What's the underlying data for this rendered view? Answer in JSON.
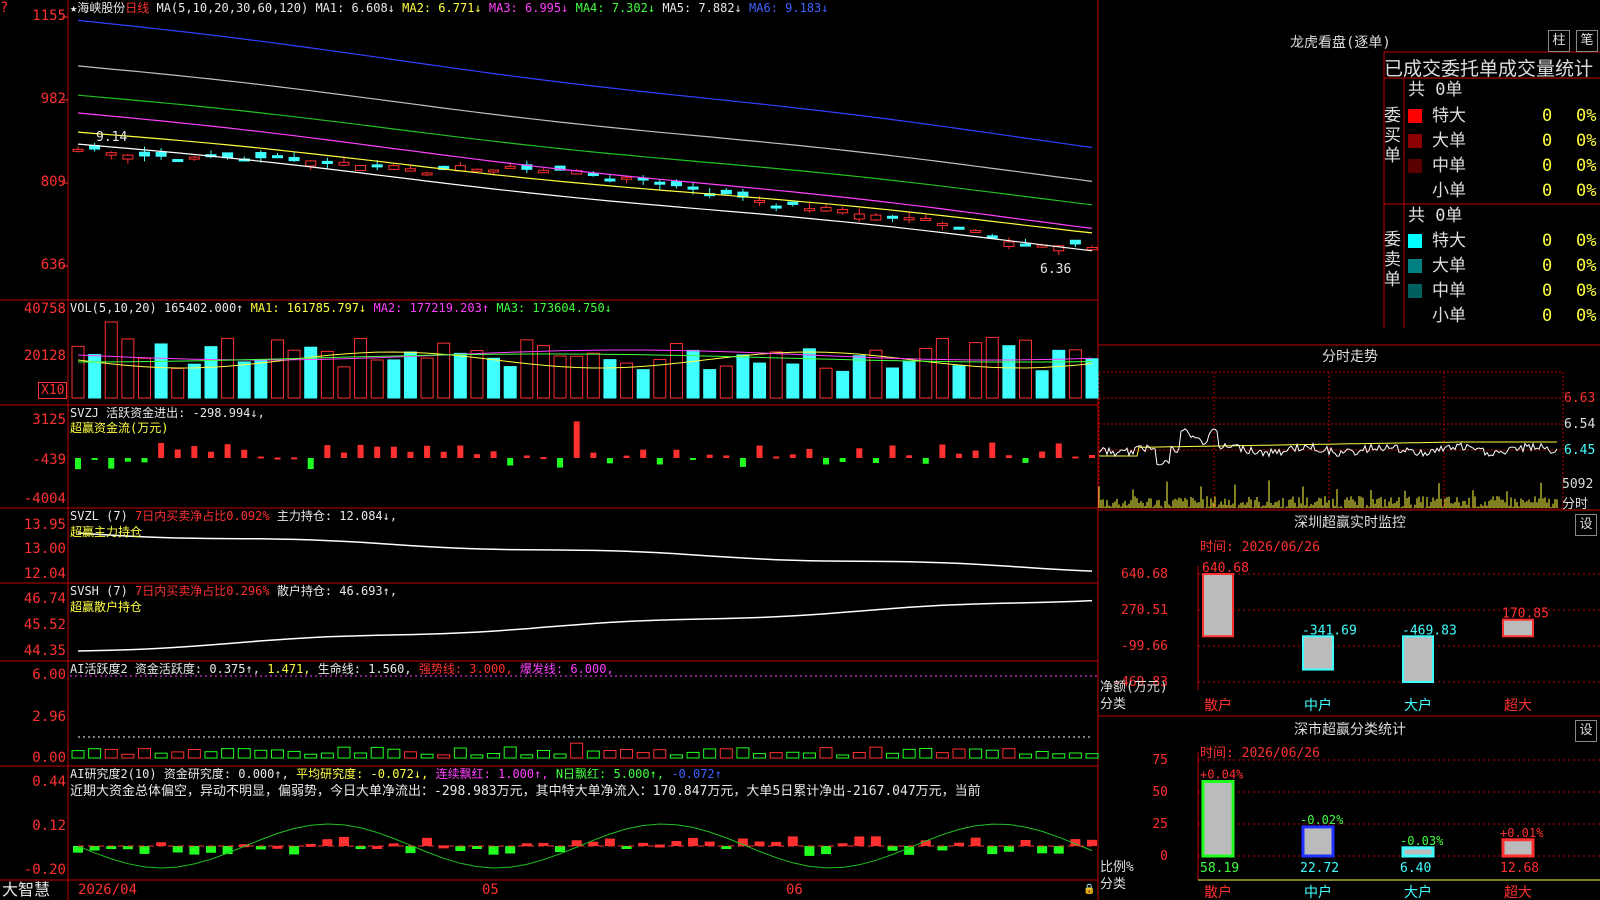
{
  "header": {
    "stock_name": "★海峡股份",
    "period": "日线",
    "ma_text": "MA(5,10,20,30,60,120)",
    "ma1": "MA1: 6.608↓",
    "ma2": "MA2: 6.771↓",
    "ma3": "MA3: 6.995↓",
    "ma4": "MA4: 7.302↓",
    "ma5": "MA5: 7.882↓",
    "ma6": "MA6: 9.183↓",
    "top_marker": "?",
    "high_label": "9.14",
    "low_label": "6.36"
  },
  "price_axis": [
    "1155",
    "982",
    "809",
    "636"
  ],
  "vol_panel": {
    "title": "VOL(5,10,20)",
    "value": "165402.000↑",
    "ma1": "MA1: 161785.797↓",
    "ma2": "MA2: 177219.203↑",
    "ma3": "MA3: 173604.750↓",
    "axis": [
      "40758",
      "20128"
    ],
    "unit": "X10"
  },
  "svzj_panel": {
    "title": "SVZJ",
    "label": "活跃资金进出: -298.994↓,",
    "sub": "超赢资金流(万元)",
    "axis": [
      "3125",
      "-439",
      "-4004"
    ]
  },
  "svzl_panel": {
    "title": "SVZL (7)",
    "ratio": "7日内买卖净占比0.092%",
    "hold": "主力持仓: 12.084↓,",
    "sub": "超赢主力持仓",
    "axis": [
      "13.95",
      "13.00",
      "12.04"
    ]
  },
  "svsh_panel": {
    "title": "SVSH (7)",
    "ratio": "7日内买卖净占比0.296%",
    "hold": "散户持仓: 46.693↑,",
    "sub": "超赢散户持仓",
    "axis": [
      "46.74",
      "45.52",
      "44.35"
    ]
  },
  "ai_panel": {
    "title": "AI活跃度2",
    "a1": "资金活跃度: 0.375↑,",
    "a2": "1.471,",
    "a3": "生命线: 1.560,",
    "a4": "强势线: 3.000,",
    "a5": "爆发线: 6.000,",
    "axis": [
      "6.00",
      "2.96",
      "0.00"
    ]
  },
  "research_panel": {
    "title": "AI研究度2(10)",
    "r1": "资金研究度: 0.000↑,",
    "r2": "平均研究度: -0.072↓,",
    "r3": "连续飘红: 1.000↑,",
    "r4": "N日飘红: 5.000↑,",
    "r5": "-0.072↑",
    "text": "近期大资金总体偏空，异动不明显，偏弱势，今日大单净流出：-298.983万元，其中特大单净流入：170.847万元，大单5日累计净出-2167.047万元，当前",
    "axis": [
      "0.44",
      "0.12",
      "-0.20"
    ]
  },
  "footer": {
    "brand": "大智慧",
    "date1": "2026/04",
    "date2": "05",
    "date3": "06"
  },
  "right_top": {
    "title": "龙虎看盘(逐单)",
    "btn1": "柱",
    "btn2": "笔",
    "subtitle": "已成交委托单成交量统计",
    "buy_label": "委买单",
    "sell_label": "委卖单",
    "buy_total": "共 0单",
    "sell_total": "共 0单",
    "buy_rows": [
      {
        "name": "特大",
        "count": "0",
        "pct": "0%",
        "color": "#ff0000"
      },
      {
        "name": "大单",
        "count": "0",
        "pct": "0%",
        "color": "#8b0000"
      },
      {
        "name": "中单",
        "count": "0",
        "pct": "0%",
        "color": "#5a0000"
      },
      {
        "name": "小单",
        "count": "0",
        "pct": "0%",
        "color": ""
      }
    ],
    "sell_rows": [
      {
        "name": "特大",
        "count": "0",
        "pct": "0%",
        "color": "#00ffff"
      },
      {
        "name": "大单",
        "count": "0",
        "pct": "0%",
        "color": "#008080"
      },
      {
        "name": "中单",
        "count": "0",
        "pct": "0%",
        "color": "#006060"
      },
      {
        "name": "小单",
        "count": "0",
        "pct": "0%",
        "color": ""
      }
    ]
  },
  "intraday": {
    "title": "分时走势",
    "axis": [
      "6.63",
      "6.54",
      "6.45"
    ],
    "vol_label": "5092",
    "vol_unit": "分时"
  },
  "sz_monitor": {
    "title": "深圳超赢实时监控",
    "btn": "设",
    "time": "时间: 2026/06/26",
    "axis": [
      "640.68",
      "270.51",
      "-99.66",
      "-469.83"
    ],
    "ylabel": "净额(万元)",
    "xlabel": "分类",
    "categories": [
      "散户",
      "中户",
      "大户",
      "超大"
    ],
    "values": [
      640.68,
      -341.69,
      -469.83,
      170.85
    ],
    "value_labels": [
      "640.68",
      "-341.69",
      "-469.83",
      "170.85"
    ]
  },
  "sz_stats": {
    "title": "深市超赢分类统计",
    "btn": "设",
    "time": "时间: 2026/06/26",
    "axis": [
      "75",
      "50",
      "25",
      "0"
    ],
    "ylabel": "比例%",
    "xlabel": "分类",
    "categories": [
      "散户",
      "中户",
      "大户",
      "超大"
    ],
    "values": [
      58.19,
      22.72,
      6.4,
      12.68
    ],
    "changes": [
      "+0.04%",
      "-0.02%",
      "-0.03%",
      "+0.01%"
    ],
    "value_labels": [
      "58.19",
      "22.72",
      "6.40",
      "12.68"
    ]
  },
  "colors": {
    "up": "#ff3030",
    "down": "#40ffff",
    "grid": "#c00000"
  }
}
